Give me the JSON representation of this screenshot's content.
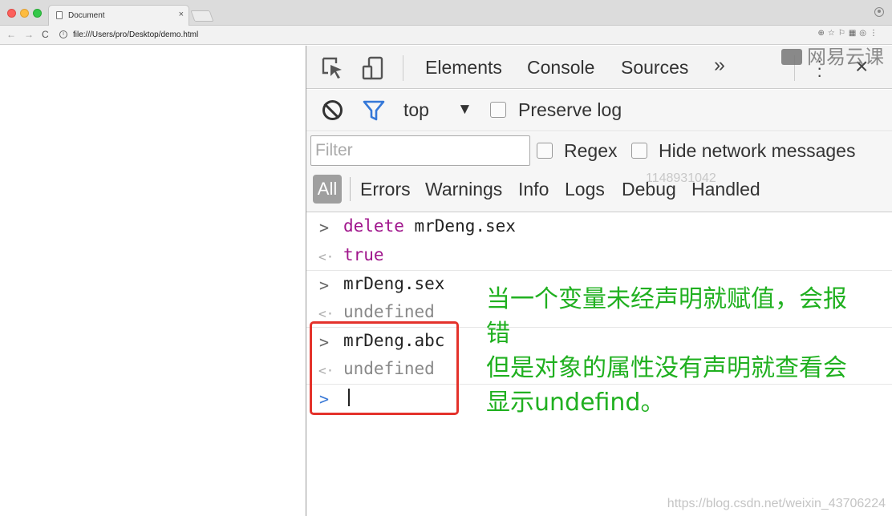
{
  "browser": {
    "tab_title": "Document",
    "tab_close": "×",
    "url": "file:///Users/pro/Desktop/demo.html"
  },
  "devtools": {
    "tabs": [
      {
        "label": "Elements"
      },
      {
        "label": "Console",
        "active": true
      },
      {
        "label": "Sources"
      }
    ],
    "more_tabs": "»",
    "close": "×",
    "context": "top",
    "preserve_log": "Preserve log",
    "filter_placeholder": "Filter",
    "regex": "Regex",
    "hide_network": "Hide network messages",
    "levels": [
      "All",
      "Errors",
      "Warnings",
      "Info",
      "Logs",
      "Debug",
      "Handled"
    ]
  },
  "console": {
    "lines": [
      {
        "type": "input",
        "keyword": "delete",
        "text": " mrDeng.sex"
      },
      {
        "type": "output",
        "text": "true"
      },
      {
        "type": "input",
        "text": "mrDeng.sex"
      },
      {
        "type": "output",
        "text": "undefined"
      },
      {
        "type": "input",
        "text": "mrDeng.abc"
      },
      {
        "type": "output",
        "text": "undefined"
      }
    ]
  },
  "annotation": {
    "lines": [
      "当一个变量未经声明就赋值，会报",
      "错",
      "但是对象的属性没有声明就查看会",
      "显示undefind。"
    ]
  },
  "watermarks": {
    "logo_text": "网易云课",
    "faint_id": "1148931042",
    "csdn": "https://blog.csdn.net/weixin_43706224"
  },
  "colors": {
    "annotation_green": "#20b020",
    "red_box": "#e4322b",
    "keyword_purple": "#a0168c",
    "prompt_blue": "#3878d6"
  }
}
